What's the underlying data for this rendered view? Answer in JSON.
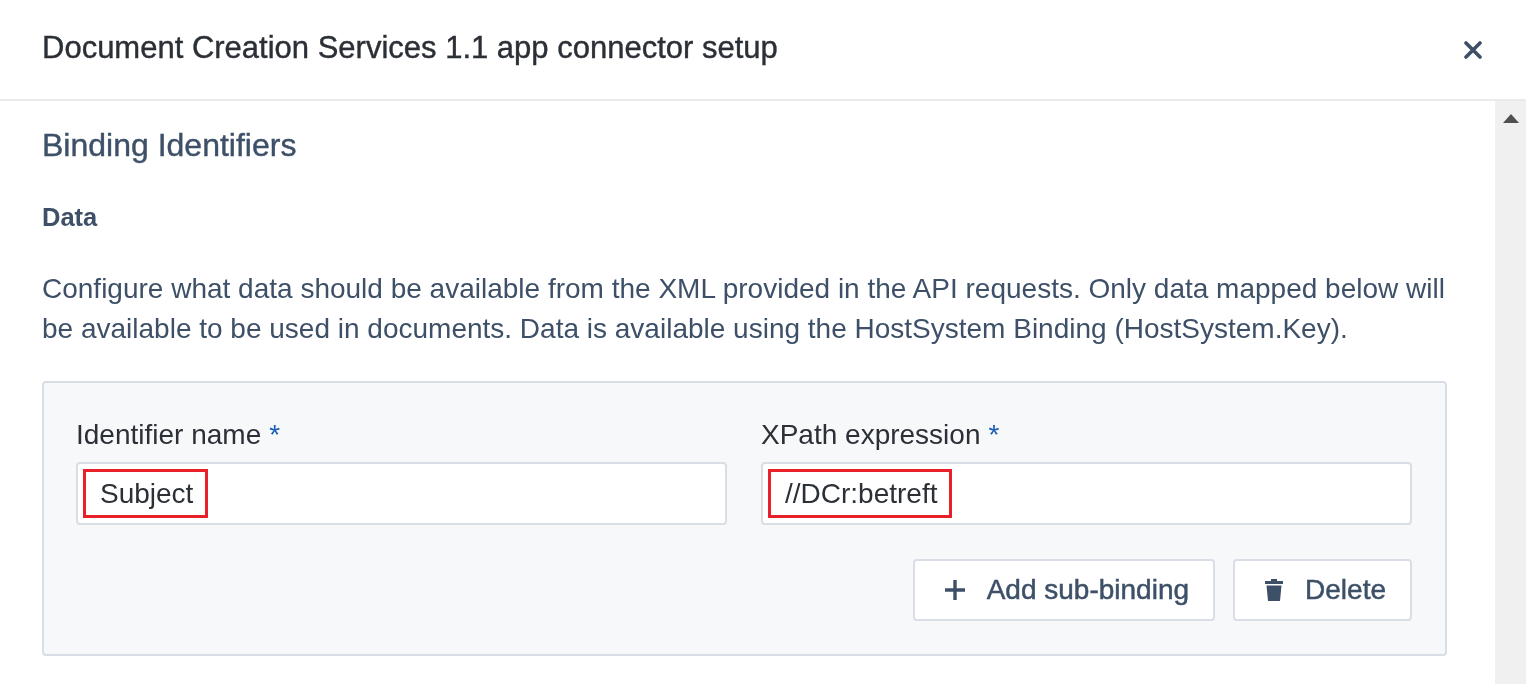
{
  "dialog": {
    "title": "Document Creation Services 1.1 app connector setup"
  },
  "section": {
    "heading": "Binding Identifiers",
    "subheading": "Data",
    "description": "Configure what data should be available from the XML provided in the API requests. Only data mapped below will be available to be used in documents. Data is available using the HostSystem Binding (HostSystem.Key)."
  },
  "binding": {
    "fields": [
      {
        "label": "Identifier name",
        "required_mark": "*",
        "value": "Subject",
        "highlighted": true
      },
      {
        "label": "XPath expression",
        "required_mark": "*",
        "value": "//DCr:betreft",
        "highlighted": true
      }
    ],
    "buttons": [
      {
        "kind": "add",
        "label": "Add sub-binding"
      },
      {
        "kind": "delete",
        "label": "Delete"
      }
    ]
  }
}
